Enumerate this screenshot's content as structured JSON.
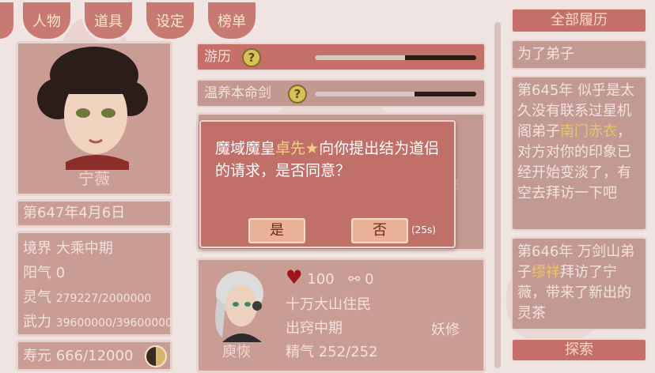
{
  "tabs": [
    "人物",
    "道具",
    "设定",
    "榜单"
  ],
  "character": {
    "name": "宁薇",
    "date": "第647年4月6日",
    "realm_label": "境界",
    "realm_value": "大乘中期",
    "yang_label": "阳气",
    "yang_value": "0",
    "spirit_label": "灵气",
    "spirit_value": "279227/2000000",
    "force_label": "武力",
    "force_value": "39600000/39600000",
    "life_label": "寿元",
    "life_value": "666/12000"
  },
  "activities": [
    {
      "label": "游历",
      "progress": 0.56
    },
    {
      "label": "温养本命剑",
      "progress": 0.62
    }
  ],
  "mid_ghost_text": "修",
  "npc": {
    "name": "庾恢",
    "hp": "100",
    "bond": "0",
    "origin": "十万大山住民",
    "realm": "出窍中期",
    "essence": "精气 252/252",
    "tag": "妖修"
  },
  "history": {
    "header": "全部履历",
    "entries": [
      {
        "parts": [
          {
            "t": "为了弟子",
            "hl": false
          }
        ]
      },
      {
        "parts": [
          {
            "t": "第645年 似乎是太久没有联系过星机阁弟子",
            "hl": false
          },
          {
            "t": "南门赤衣",
            "hl": true
          },
          {
            "t": "，对方对你的印象已经开始变淡了，有空去拜访一下吧",
            "hl": false
          }
        ]
      },
      {
        "parts": [
          {
            "t": "第646年 万剑山弟子",
            "hl": false
          },
          {
            "t": "缪祥",
            "hl": true
          },
          {
            "t": "拜访了宁薇，带来了新出的灵茶",
            "hl": false
          }
        ]
      }
    ],
    "footer": "探索"
  },
  "dialog": {
    "text_before": "魔域魔皇",
    "highlight": "卓先★",
    "text_after": "向你提出结为道侣的请求，是否同意？",
    "yes": "是",
    "no": "否",
    "timer": "(25s)"
  },
  "colors": {
    "accent": "#c47069",
    "highlight": "#e8c46b",
    "heart": "#a0141a"
  }
}
